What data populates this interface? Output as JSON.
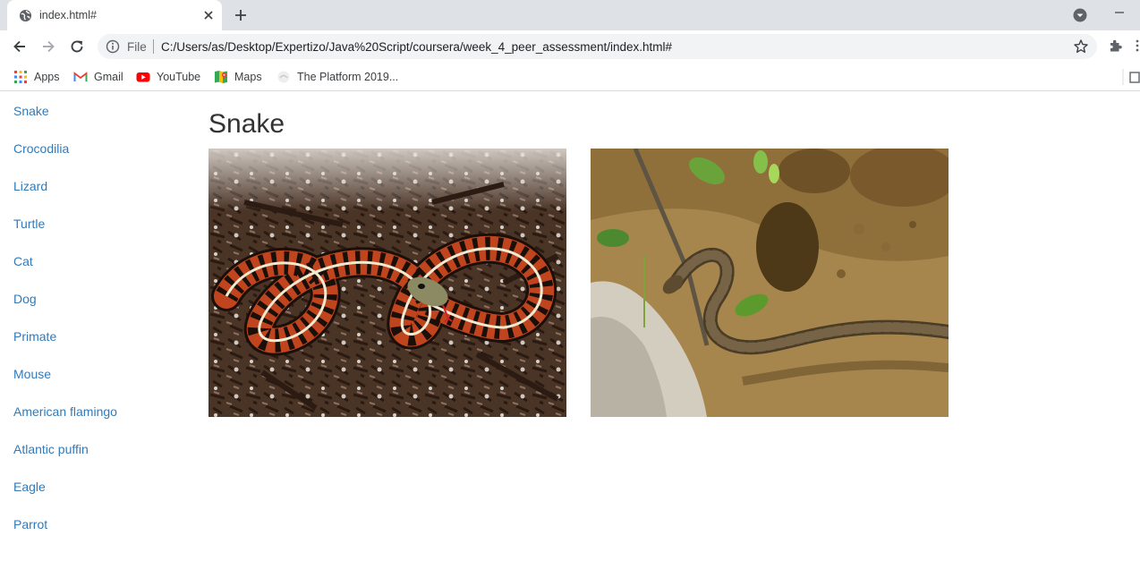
{
  "browser": {
    "tab_title": "index.html#",
    "scheme_label": "File",
    "url": "C:/Users/as/Desktop/Expertizo/Java%20Script/coursera/week_4_peer_assessment/index.html#",
    "bookmarks": [
      {
        "label": "Apps",
        "icon": "apps-grid-icon"
      },
      {
        "label": "Gmail",
        "icon": "gmail-icon"
      },
      {
        "label": "YouTube",
        "icon": "youtube-icon"
      },
      {
        "label": "Maps",
        "icon": "maps-icon"
      },
      {
        "label": "The Platform 2019...",
        "icon": "platform-icon"
      }
    ]
  },
  "page": {
    "title": "Snake",
    "nav": [
      "Snake",
      "Crocodilia",
      "Lizard",
      "Turtle",
      "Cat",
      "Dog",
      "Primate",
      "Mouse",
      "American flamingo",
      "Atlantic puffin",
      "Eagle",
      "Parrot"
    ]
  },
  "colors": {
    "link": "#337ab7",
    "heading": "#333333",
    "tabstrip": "#dee1e6",
    "omnibox": "#f1f3f4"
  }
}
